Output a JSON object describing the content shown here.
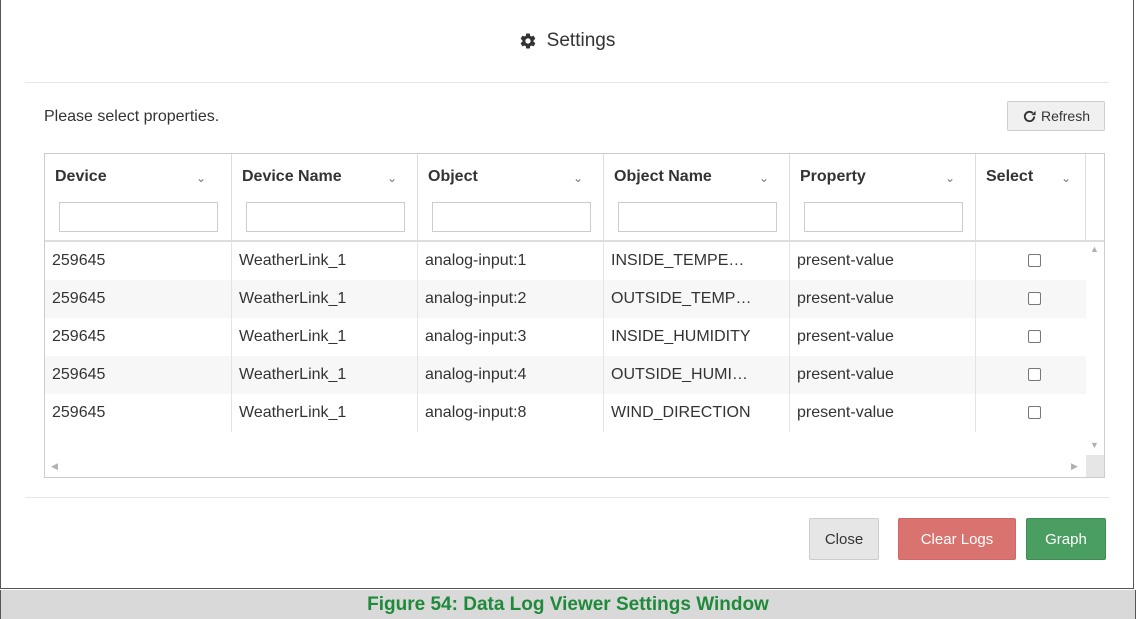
{
  "dialog": {
    "title": "Settings",
    "instructions": "Please select properties.",
    "refresh_label": "Refresh"
  },
  "grid": {
    "columns": [
      {
        "label": "Device",
        "filter": ""
      },
      {
        "label": "Device Name",
        "filter": ""
      },
      {
        "label": "Object",
        "filter": ""
      },
      {
        "label": "Object Name",
        "filter": ""
      },
      {
        "label": "Property",
        "filter": ""
      },
      {
        "label": "Select"
      }
    ],
    "rows": [
      {
        "device": "259645",
        "device_name": "WeatherLink_1",
        "object": "analog-input:1",
        "object_name": "INSIDE_TEMPE…",
        "property": "present-value",
        "selected": false
      },
      {
        "device": "259645",
        "device_name": "WeatherLink_1",
        "object": "analog-input:2",
        "object_name": "OUTSIDE_TEMP…",
        "property": "present-value",
        "selected": false
      },
      {
        "device": "259645",
        "device_name": "WeatherLink_1",
        "object": "analog-input:3",
        "object_name": "INSIDE_HUMIDITY",
        "property": "present-value",
        "selected": false
      },
      {
        "device": "259645",
        "device_name": "WeatherLink_1",
        "object": "analog-input:4",
        "object_name": "OUTSIDE_HUMI…",
        "property": "present-value",
        "selected": false
      },
      {
        "device": "259645",
        "device_name": "WeatherLink_1",
        "object": "analog-input:8",
        "object_name": "WIND_DIRECTION",
        "property": "present-value",
        "selected": false
      }
    ]
  },
  "footer": {
    "close_label": "Close",
    "clear_logs_label": "Clear Logs",
    "graph_label": "Graph"
  },
  "caption": "Figure 54: Data Log Viewer Settings Window",
  "colors": {
    "clear_logs_bg": "#d9736f",
    "graph_bg": "#4a9e62",
    "caption_text": "#1f8a3a"
  }
}
